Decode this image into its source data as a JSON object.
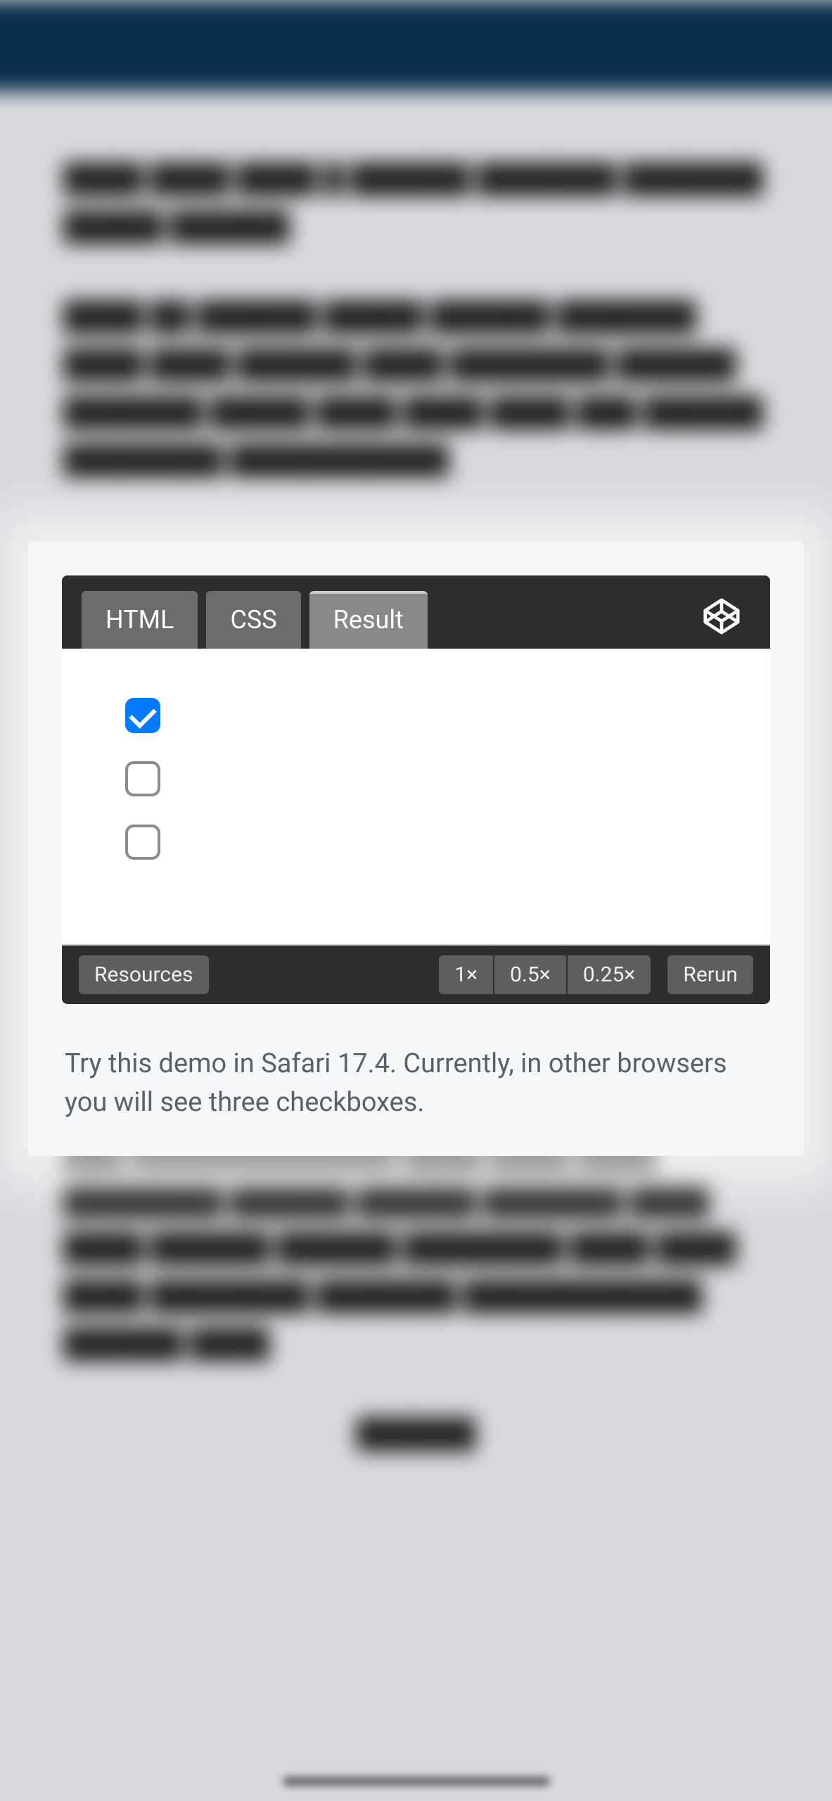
{
  "codepen": {
    "tabs": {
      "html": "HTML",
      "css": "CSS",
      "result": "Result"
    },
    "footer": {
      "resources": "Resources",
      "zoom_1x": "1×",
      "zoom_05x": "0.5×",
      "zoom_025x": "0.25×",
      "rerun": "Rerun"
    },
    "switches": [
      {
        "checked": true
      },
      {
        "checked": false
      },
      {
        "checked": false
      }
    ]
  },
  "caption": "Try this demo in Safari 17.4. Currently, in other browsers you will see three checkboxes."
}
